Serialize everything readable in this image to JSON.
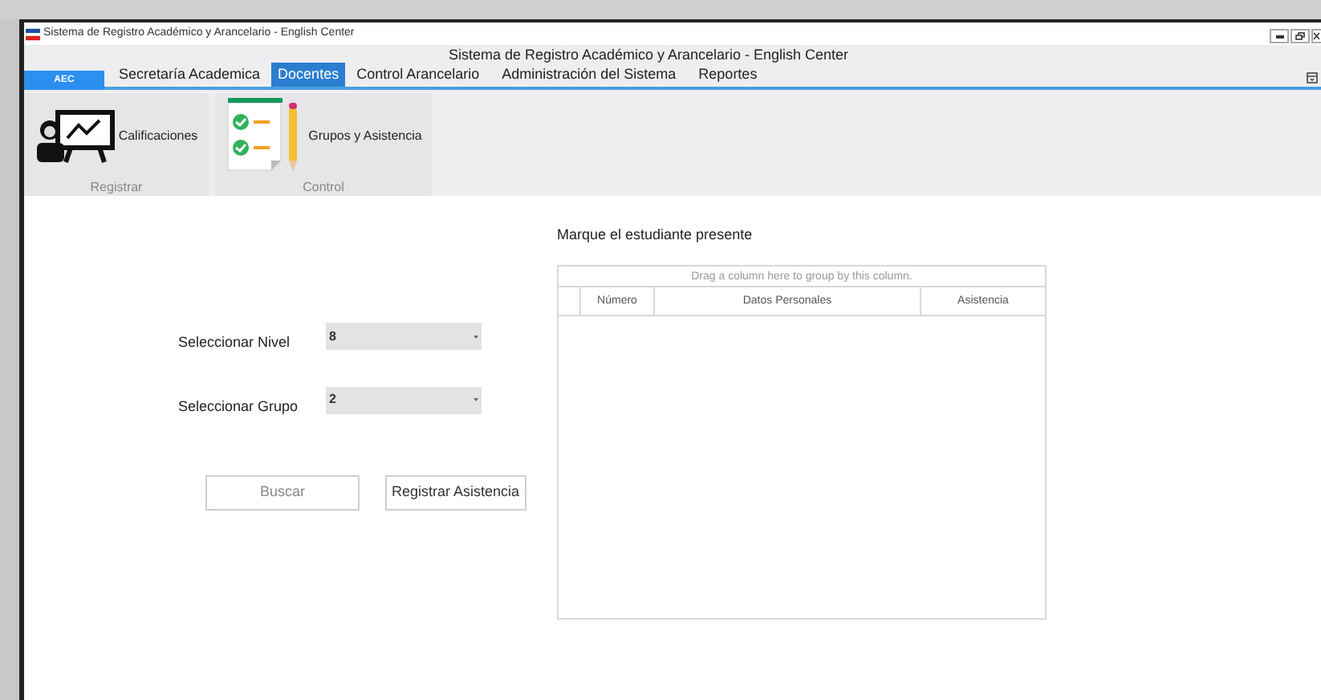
{
  "window": {
    "title": "Sistema de Registro Académico y Arancelario - English Center",
    "caption": "Sistema de Registro Académico y Arancelario - English Center"
  },
  "app_button": "AEC",
  "tabs": [
    {
      "label": "Secretaría Academica",
      "selected": false
    },
    {
      "label": "Docentes",
      "selected": true
    },
    {
      "label": "Control Arancelario",
      "selected": false
    },
    {
      "label": "Administración del Sistema",
      "selected": false
    },
    {
      "label": "Reportes",
      "selected": false
    }
  ],
  "ribbon_groups": [
    {
      "caption": "Registrar",
      "items": [
        {
          "label": "Calificaciones",
          "kind": "teacher"
        }
      ]
    },
    {
      "caption": "Control",
      "items": [
        {
          "label": "Grupos y Asistencia",
          "kind": "checklist"
        }
      ]
    }
  ],
  "form": {
    "fields": [
      {
        "label": "Seleccionar Nivel",
        "value": "8"
      },
      {
        "label": "Seleccionar Grupo",
        "value": "2"
      }
    ],
    "buttons": [
      {
        "label": "Buscar",
        "disabled": true
      },
      {
        "label": "Registrar Asistencia",
        "disabled": false
      }
    ]
  },
  "grid": {
    "title": "Marque el estudiante presente",
    "group_panel": "Drag a column here to group by this column.",
    "columns": [
      "Número",
      "Datos Personales",
      "Asistencia"
    ]
  }
}
